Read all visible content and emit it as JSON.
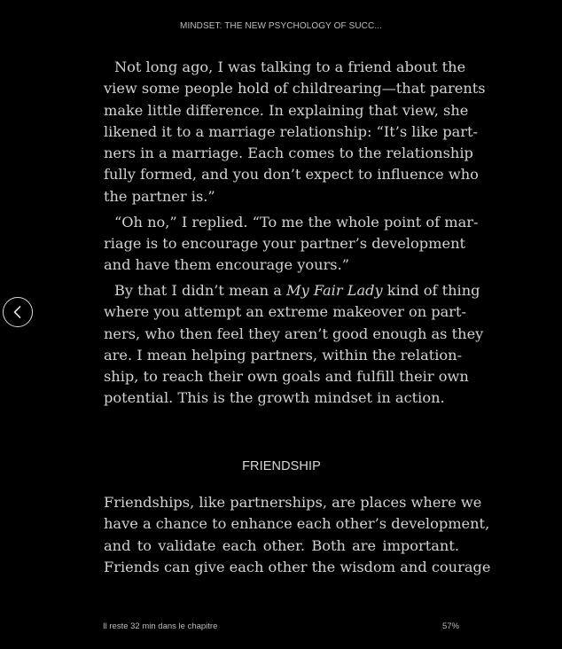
{
  "header": {
    "book_title": "MINDSET: THE NEW PSYCHOLOGY OF SUCC..."
  },
  "navigation": {
    "back_icon": "chevron-left-icon"
  },
  "content": {
    "paragraph1": [
      "Not long ago, I was talking to a friend about the",
      "view some people hold of childrearing—that parents",
      "make little difference. In explaining that view, she",
      "likened it to a marriage relationship: “It’s like part-",
      "ners in a marriage. Each comes to the relationship",
      "fully formed, and you don’t expect to influence who",
      "the partner is.”"
    ],
    "paragraph2": [
      "“Oh no,” I replied. “To me the whole point of mar-",
      "riage is to encourage your partner’s development",
      "and have them encourage yours.”"
    ],
    "paragraph3_lead": "By that I didn’t mean a ",
    "paragraph3_italic": "My Fair Lady",
    "paragraph3_tail": " kind of thing",
    "paragraph3": [
      "where you attempt an extreme makeover on part-",
      "ners, who then feel they aren’t good enough as they",
      "are. I mean helping partners, within the relation-",
      "ship, to reach their own goals and fulfill their own",
      "potential. This is the growth mindset in action."
    ],
    "section_heading": "FRIENDSHIP",
    "paragraph4": [
      "Friendships, like partnerships, are places where we",
      "have a chance to enhance each other’s development,",
      "and to validate each other. Both are important.",
      "Friends can give each other the wisdom and courage"
    ]
  },
  "footer": {
    "time_left": "Il reste 32 min dans le chapitre",
    "progress_label": "57%"
  },
  "colors": {
    "background": "#000000",
    "text": "#d2d2d2"
  }
}
